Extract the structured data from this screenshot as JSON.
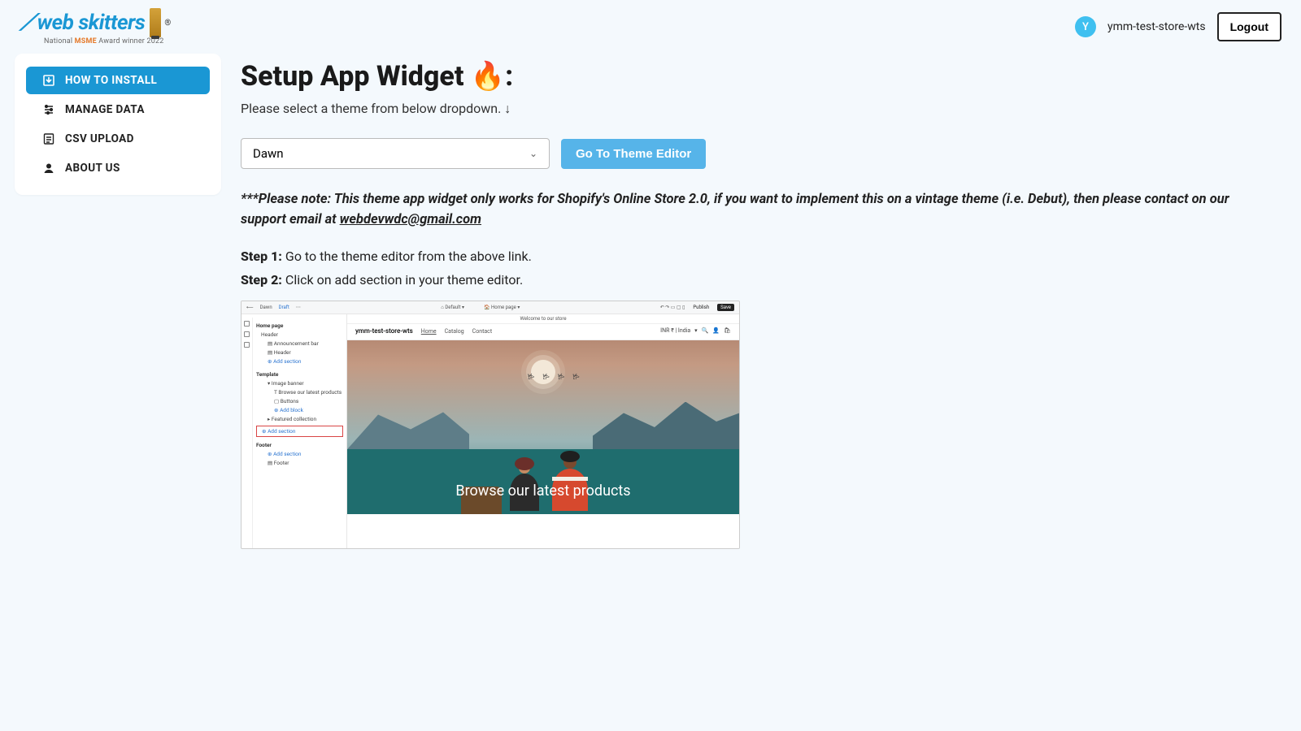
{
  "header": {
    "logo_main": "Web skitters",
    "logo_r": "®",
    "logo_sub_pre": "National ",
    "logo_sub_em": "MSME",
    "logo_sub_post": " Award winner 2022",
    "store": "ymm-test-store-wts",
    "avatar_initial": "Y",
    "logout": "Logout"
  },
  "sidebar": {
    "items": [
      {
        "label": "HOW TO INSTALL",
        "active": true,
        "icon": "install-icon"
      },
      {
        "label": "MANAGE DATA",
        "active": false,
        "icon": "sliders-icon"
      },
      {
        "label": "CSV UPLOAD",
        "active": false,
        "icon": "csv-icon"
      },
      {
        "label": "ABOUT US",
        "active": false,
        "icon": "user-icon"
      }
    ]
  },
  "main": {
    "title": "Setup App Widget 🔥:",
    "subtitle": "Please select a theme from below dropdown. ↓",
    "theme_selected": "Dawn",
    "go_button": "Go To Theme Editor",
    "note_pre": "***Please note: This theme app widget only works for Shopify's Online Store 2.0, if you want to implement this on a vintage theme (i.e. Debut), then please contact on our support email at ",
    "note_email": "webdevwdc@gmail.com",
    "step1_label": "Step 1:",
    "step1_text": " Go to the theme editor from the above link.",
    "step2_label": "Step 2:",
    "step2_text": " Click on add section in your theme editor."
  },
  "screenshot": {
    "top_left_theme": "Dawn",
    "top_left_status": "Draft",
    "top_mid_left": "Default",
    "top_mid_right": "Home page",
    "publish": "Publish",
    "save": "Save",
    "panel": {
      "page": "Home page",
      "header_group": "Header",
      "announcement": "Announcement bar",
      "header_item": "Header",
      "add_section_header": "Add section",
      "template_group": "Template",
      "image_banner": "Image banner",
      "browse_products": "Browse our latest products",
      "buttons": "Buttons",
      "add_block": "Add block",
      "featured": "Featured collection",
      "add_section_template": "Add section",
      "footer_group": "Footer",
      "add_section_footer": "Add section",
      "footer_item": "Footer"
    },
    "canvas": {
      "strip": "Welcome to our store",
      "store": "ymm-test-store-wts",
      "nav_home": "Home",
      "nav_catalog": "Catalog",
      "nav_contact": "Contact",
      "lang": "INR ₹ | India",
      "hero_text": "Browse our latest products"
    }
  }
}
